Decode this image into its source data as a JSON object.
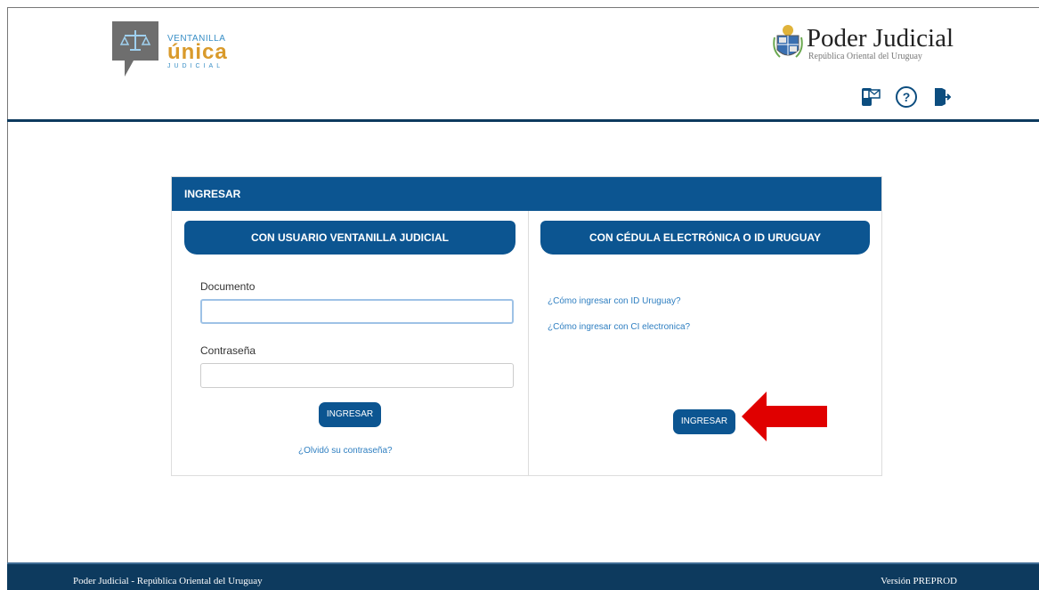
{
  "brand_left": {
    "line1": "VENTANILLA",
    "line2": "única",
    "line3": "JUDICIAL"
  },
  "brand_right": {
    "title": "Poder Judicial",
    "subtitle": "República Oriental del Uruguay"
  },
  "header_icons": [
    "phone-mail-icon",
    "help-icon",
    "logout-icon"
  ],
  "panel": {
    "title": "INGRESAR",
    "left": {
      "tab": "CON USUARIO VENTANILLA JUDICIAL",
      "doc_label": "Documento",
      "doc_value": "",
      "pass_label": "Contraseña",
      "pass_value": "",
      "button": "INGRESAR",
      "forgot": "¿Olvidó su contraseña?"
    },
    "right": {
      "tab": "CON CÉDULA ELECTRÓNICA O ID URUGUAY",
      "link1": "¿Cómo ingresar con ID Uruguay?",
      "link2": "¿Cómo ingresar con CI electronica?",
      "button": "INGRESAR"
    }
  },
  "footer": {
    "left": "Poder Judicial - República Oriental del Uruguay",
    "right": "Versión PREPROD"
  },
  "colors": {
    "primary": "#0c5591",
    "dark": "#0d3a5e",
    "accent_red": "#e00000",
    "gold": "#d99a2b"
  }
}
